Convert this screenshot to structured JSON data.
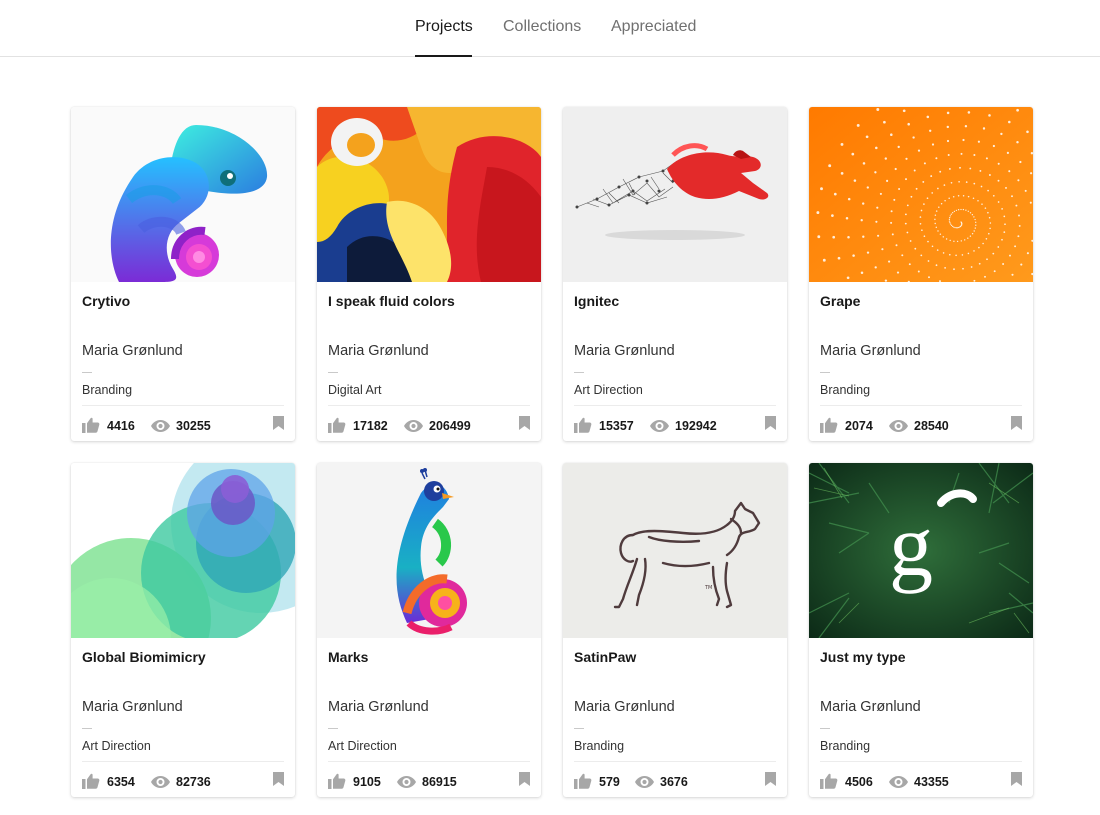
{
  "tabs": [
    {
      "label": "Projects",
      "active": true
    },
    {
      "label": "Collections",
      "active": false
    },
    {
      "label": "Appreciated",
      "active": false
    }
  ],
  "projects": [
    {
      "title": "Crytivo",
      "owner": "Maria Grønlund",
      "field": "Branding",
      "likes": "4416",
      "views": "30255",
      "cover": "chameleon"
    },
    {
      "title": "I speak fluid colors",
      "owner": "Maria Grønlund",
      "field": "Digital Art",
      "likes": "17182",
      "views": "206499",
      "cover": "fluid"
    },
    {
      "title": "Ignitec",
      "owner": "Maria Grønlund",
      "field": "Art Direction",
      "likes": "15357",
      "views": "192942",
      "cover": "rabbit"
    },
    {
      "title": "Grape",
      "owner": "Maria Grønlund",
      "field": "Branding",
      "likes": "2074",
      "views": "28540",
      "cover": "spiral"
    },
    {
      "title": "Global Biomimicry",
      "owner": "Maria Grønlund",
      "field": "Art Direction",
      "likes": "6354",
      "views": "82736",
      "cover": "circles"
    },
    {
      "title": "Marks",
      "owner": "Maria Grønlund",
      "field": "Art Direction",
      "likes": "9105",
      "views": "86915",
      "cover": "peacock"
    },
    {
      "title": "SatinPaw",
      "owner": "Maria Grønlund",
      "field": "Branding",
      "likes": "579",
      "views": "3676",
      "cover": "dog"
    },
    {
      "title": "Just my type",
      "owner": "Maria Grønlund",
      "field": "Branding",
      "likes": "4506",
      "views": "43355",
      "cover": "letter-g"
    }
  ],
  "icons": {
    "like": "thumbs-up-icon",
    "view": "eye-icon",
    "save": "bookmark-icon"
  },
  "colors": {
    "icon_gray": "#a7a7a7",
    "text": "#191919"
  }
}
